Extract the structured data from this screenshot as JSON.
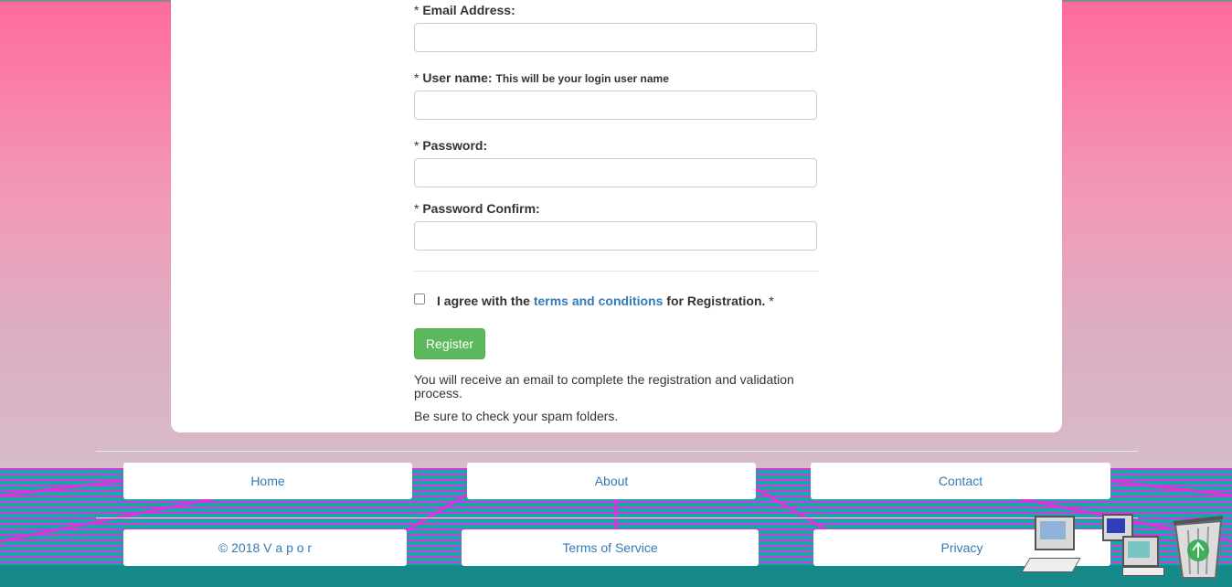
{
  "form": {
    "email_label": "Email Address:",
    "username_label": "User name:",
    "username_hint": "This will be your login user name",
    "password_label": "Password:",
    "password_confirm_label": "Password Confirm:",
    "required_mark": "*",
    "email_value": "",
    "username_value": "",
    "password_value": "",
    "password_confirm_value": "",
    "agree_prefix": "I agree with the",
    "agree_link": "terms and conditions",
    "agree_suffix": "for Registration.",
    "agree_checked": false,
    "register_label": "Register",
    "info_line1": "You will receive an email to complete the registration and validation process.",
    "info_line2": "Be sure to check your spam folders."
  },
  "footer": {
    "nav_row1": [
      "Home",
      "About",
      "Contact"
    ],
    "nav_row2": [
      "© 2018 V a p o r",
      "Terms of Service",
      "Privacy"
    ]
  },
  "desktop_icons": [
    "my-computer-icon",
    "network-icon",
    "recycle-bin-icon"
  ],
  "colors": {
    "accent_link": "#337ab7",
    "register_button": "#5cb85c",
    "bg_top": "#ff6b9b",
    "grid_line": "#e030e0",
    "grid_floor": "#1aa6a6"
  }
}
